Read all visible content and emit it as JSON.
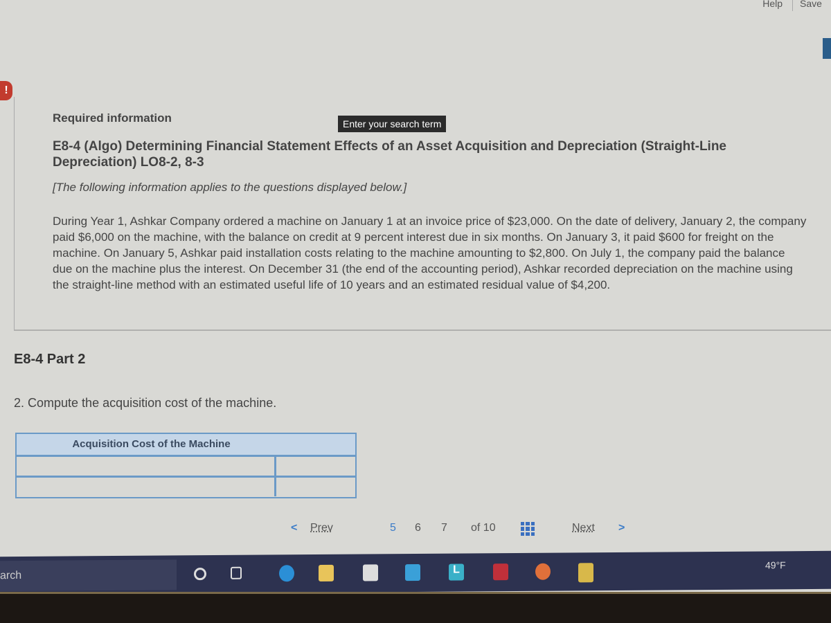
{
  "topbar": {
    "help": "Help",
    "save": "Save"
  },
  "alert_icon": "!",
  "info": {
    "heading": "Required information",
    "search_tooltip": "Enter your search term",
    "title": "E8-4 (Algo) Determining Financial Statement Effects of an Asset Acquisition and Depreciation (Straight-Line Depreciation) LO8-2, 8-3",
    "note": "[The following information applies to the questions displayed below.]",
    "paragraph": "During Year 1, Ashkar Company ordered a machine on January 1 at an invoice price of $23,000. On the date of delivery, January 2, the company paid $6,000 on the machine, with the balance on credit at 9 percent interest due in six months. On January 3, it paid $600 for freight on the machine. On January 5, Ashkar paid installation costs relating to the machine amounting to $2,800. On July 1, the company paid the balance due on the machine plus the interest. On December 31 (the end of the accounting period), Ashkar recorded depreciation on the machine using the straight-line method with an estimated useful life of 10 years and an estimated residual value of $4,200."
  },
  "part": {
    "title": "E8-4 Part 2",
    "question": "2. Compute the acquisition cost of the machine."
  },
  "table": {
    "header": "Acquisition Cost of the Machine",
    "rows": [
      [
        "",
        ""
      ],
      [
        "",
        ""
      ]
    ]
  },
  "pager": {
    "prev": "Prev",
    "pages": [
      "5",
      "6",
      "7"
    ],
    "current": "5",
    "of": "of 10",
    "next": "Next"
  },
  "taskbar": {
    "search": "arch",
    "temperature": "49°F"
  }
}
